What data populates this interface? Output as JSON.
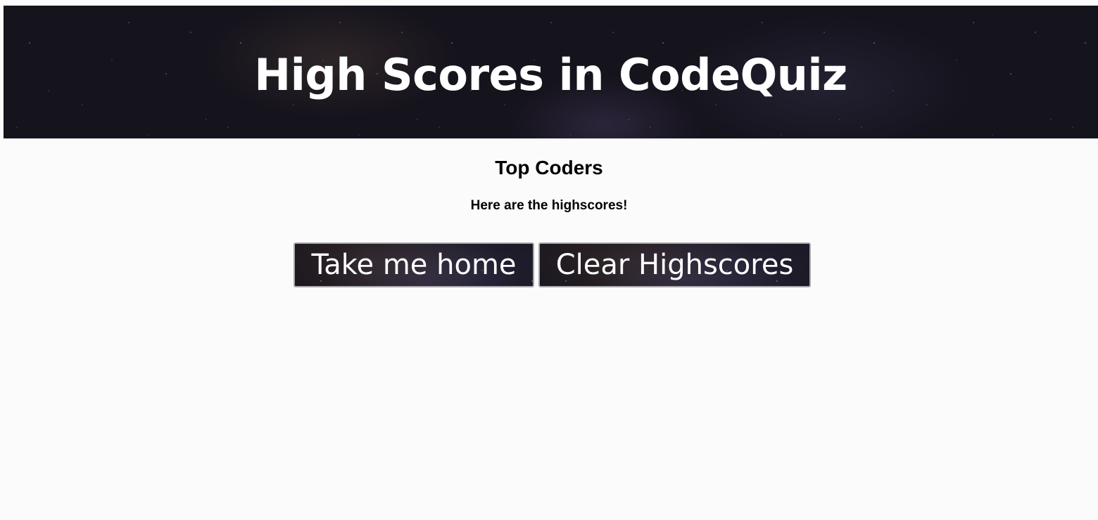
{
  "header": {
    "title": "High Scores in CodeQuiz"
  },
  "main": {
    "heading": "Top Coders",
    "subheading": "Here are the highscores!",
    "highscores": []
  },
  "actions": {
    "home_label": "Take me home",
    "clear_label": "Clear Highscores"
  },
  "colors": {
    "page_background": "#fbfbfb",
    "banner_background": "#15131c",
    "button_text": "#ffffff",
    "button_border": "#a9a9ad"
  }
}
